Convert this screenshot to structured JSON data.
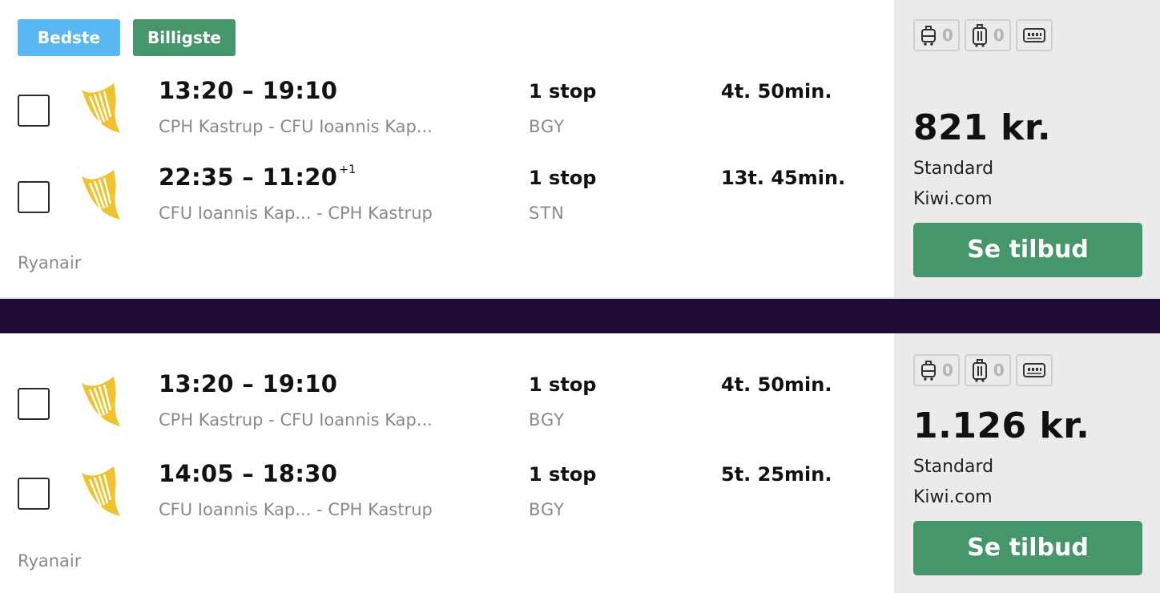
{
  "results": [
    {
      "badges": {
        "best": "Bedste",
        "cheapest": "Billigste"
      },
      "legs": [
        {
          "dep": "13:20",
          "sep": "–",
          "arr": "19:10",
          "day_offset": "",
          "route": "CPH Kastrup - CFU Ioannis Kap...",
          "stops": "1 stop",
          "via": "BGY",
          "duration": "4t. 50min."
        },
        {
          "dep": "22:35",
          "sep": "–",
          "arr": "11:20",
          "day_offset": "+1",
          "route": "CFU Ioannis Kap...   - CPH Kastrup",
          "stops": "1 stop",
          "via": "STN",
          "duration": "13t. 45min."
        }
      ],
      "airline": "Ryanair",
      "bags": {
        "cabin_count": "0",
        "checked_count": "0",
        "cabin_icon": "cabin-bag-icon",
        "checked_icon": "checked-bag-icon",
        "fare_icon": "fare-card-icon"
      },
      "price": "821 kr.",
      "fare_type": "Standard",
      "provider": "Kiwi.com",
      "cta": "Se tilbud"
    },
    {
      "legs": [
        {
          "dep": "13:20",
          "sep": "–",
          "arr": "19:10",
          "day_offset": "",
          "route": "CPH Kastrup - CFU Ioannis Kap...",
          "stops": "1 stop",
          "via": "BGY",
          "duration": "4t. 50min."
        },
        {
          "dep": "14:05",
          "sep": "–",
          "arr": "18:30",
          "day_offset": "",
          "route": "CFU Ioannis Kap...   - CPH Kastrup",
          "stops": "1 stop",
          "via": "BGY",
          "duration": "5t. 25min."
        }
      ],
      "airline": "Ryanair",
      "bags": {
        "cabin_count": "0",
        "checked_count": "0",
        "cabin_icon": "cabin-bag-icon",
        "checked_icon": "checked-bag-icon",
        "fare_icon": "fare-card-icon"
      },
      "price": "1.126 kr.",
      "fare_type": "Standard",
      "provider": "Kiwi.com",
      "cta": "Se tilbud"
    }
  ],
  "colors": {
    "brand_green": "#45976b",
    "badge_blue": "#59b7f1",
    "background": "#1e0a36",
    "airline_logo": "#f0c22e"
  }
}
